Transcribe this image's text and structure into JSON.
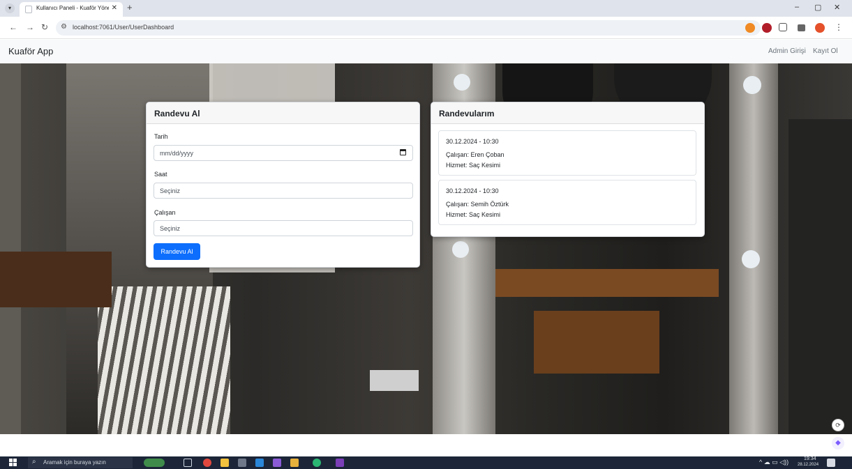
{
  "browser": {
    "tab_title": "Kullanıcı Paneli - Kuaför Yöneti",
    "tab_close": "✕",
    "new_tab": "+",
    "url": "localhost:7061/User/UserDashboard",
    "window_controls": [
      "–",
      "▢",
      "✕"
    ]
  },
  "navbar": {
    "brand": "Kuaför App",
    "links": [
      "Admin Girişi",
      "Kayıt Ol"
    ]
  },
  "appointment_form": {
    "title": "Randevu Al",
    "date_label": "Tarih",
    "date_value": "mm/dd/yyyy",
    "time_label": "Saat",
    "time_value": "Seçiniz",
    "employee_label": "Çalışan",
    "employee_value": "Seçiniz",
    "submit_label": "Randevu Al"
  },
  "my_appointments": {
    "title": "Randevularım",
    "items": [
      {
        "datetime": "30.12.2024 - 10:30",
        "employee": "Çalışan: Eren Çoban",
        "service": "Hizmet: Saç Kesimi"
      },
      {
        "datetime": "30.12.2024 - 10:30",
        "employee": "Çalışan: Semih Öztürk",
        "service": "Hizmet: Saç Kesimi"
      }
    ]
  },
  "taskbar": {
    "search_placeholder": "Aramak için buraya yazın",
    "time": "19:34",
    "date": "28.12.2024"
  },
  "colors": {
    "primary": "#0d6efd",
    "navbar_bg": "#f8f9fa",
    "taskbar_bg": "#1c2638"
  }
}
